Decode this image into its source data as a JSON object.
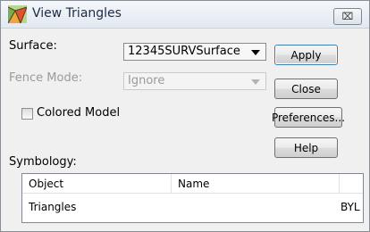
{
  "window": {
    "title": "View Triangles",
    "close_glyph": "⌧"
  },
  "form": {
    "surface_label": "Surface:",
    "surface_value": "12345SURVSurface",
    "fence_mode_label": "Fence Mode:",
    "fence_mode_value": "Ignore",
    "colored_model_label": "Colored Model",
    "colored_model_checked": false,
    "symbology_label": "Symbology:"
  },
  "buttons": {
    "apply": "Apply",
    "close": "Close",
    "preferences": "Preferences...",
    "help": "Help"
  },
  "symbology_table": {
    "columns": [
      "Object",
      "Name"
    ],
    "rows": [
      {
        "object": "Triangles",
        "name": "BYL"
      }
    ]
  }
}
